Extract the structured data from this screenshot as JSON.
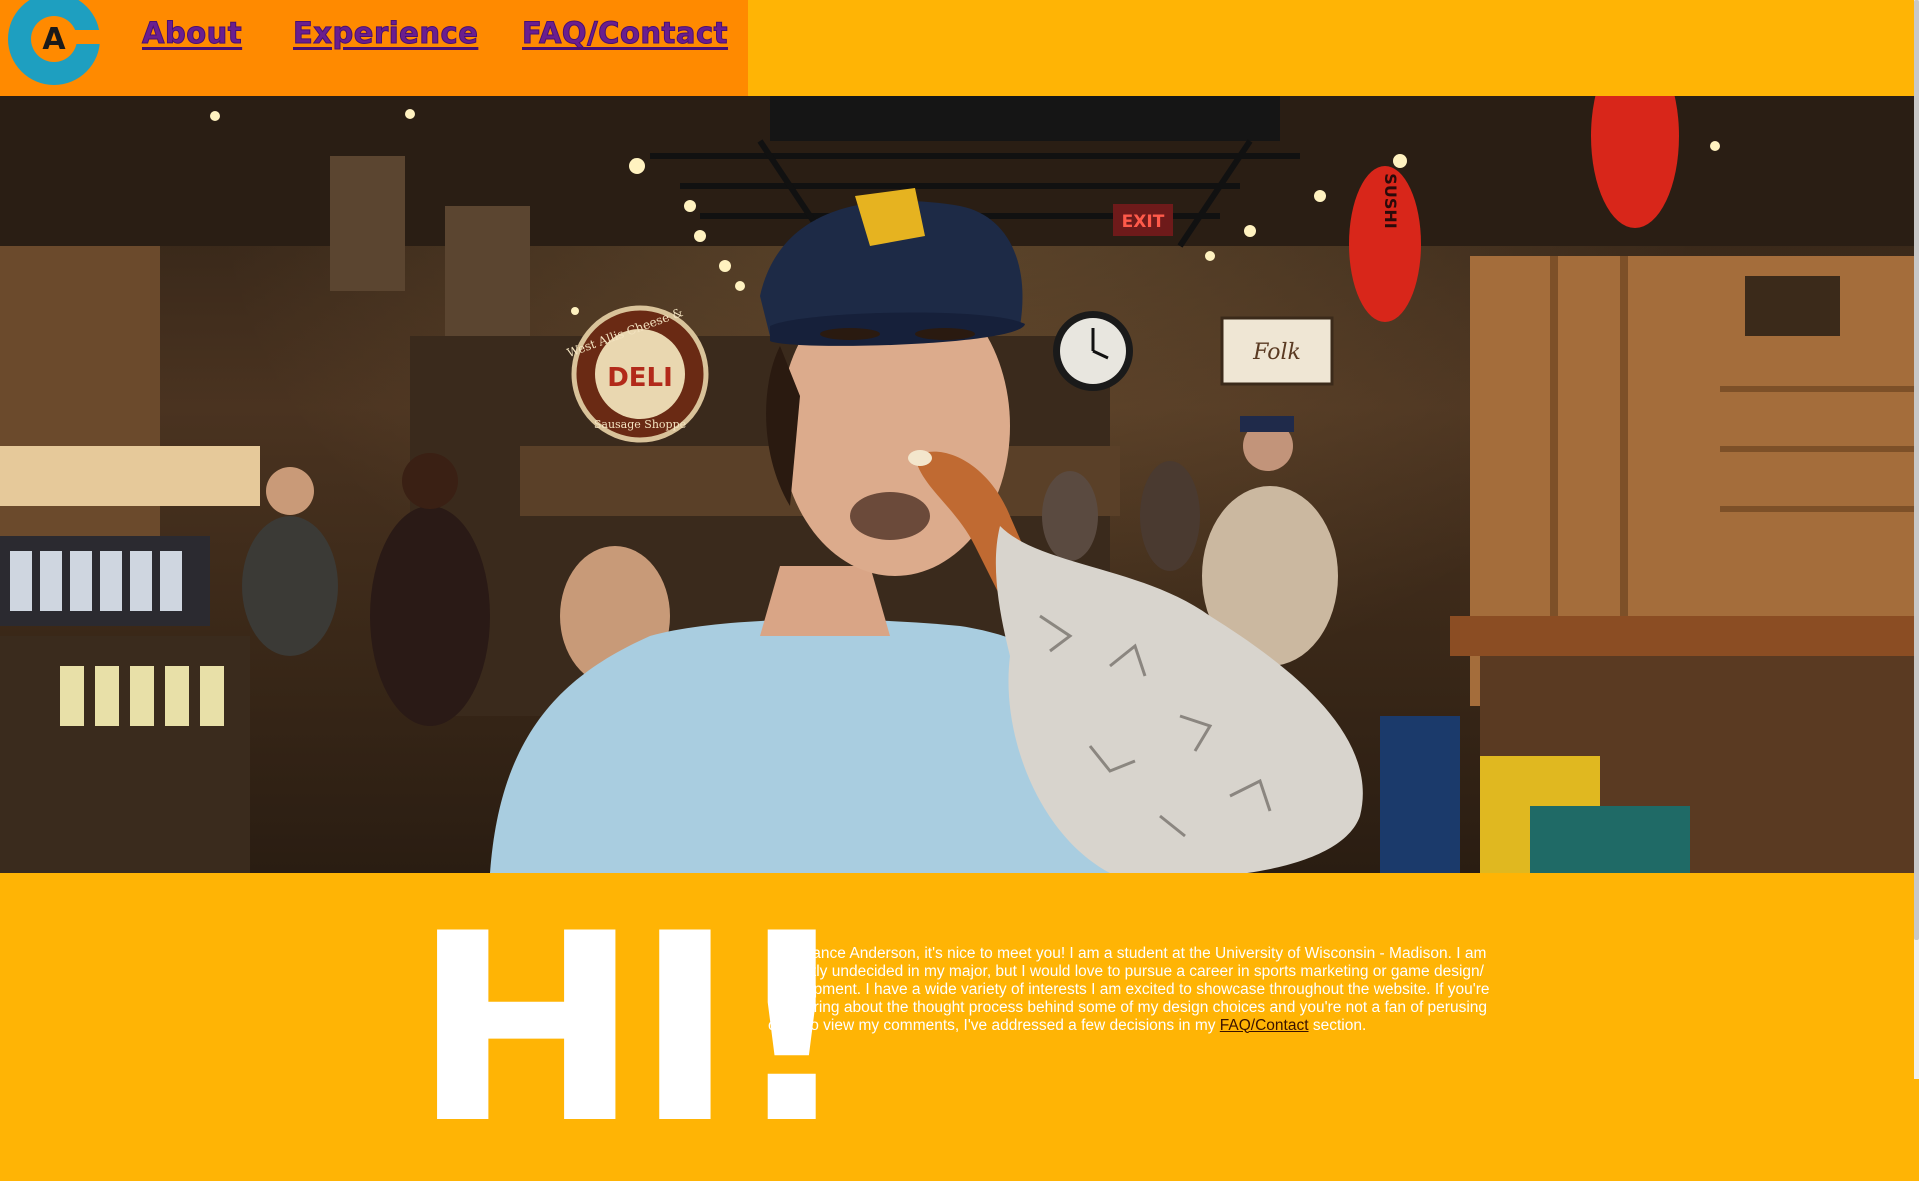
{
  "logo": {
    "letter": "A",
    "alt": "Chance Anderson logo"
  },
  "nav": {
    "about": "About",
    "experience": "Experience",
    "faq": "FAQ/Contact"
  },
  "hero": {
    "signs": {
      "deli_top": "West Allis Cheese &",
      "deli_main": "DELI",
      "deli_bottom": "Sausage Shoppe",
      "exit": "EXIT",
      "sushi": "SUSHI",
      "folk": "Folk"
    }
  },
  "intro": {
    "heading": "HI!",
    "text_before_link": "I'm Chance Anderson, it's nice to meet you! I am a student at the University of Wisconsin - Madison. I am currently undecided in my major, but I would love to pursue a career in sports marketing or game design/ development. I have a wide variety of interests I am excited to showcase throughout the website. If you're wondering about the thought process behind some of my design choices and you're not a fan of perusing code to view my comments, I've addressed a few decisions in my ",
    "link_label": "FAQ/Contact",
    "text_after_link": " section."
  },
  "colors": {
    "page_bg": "#FFB405",
    "nav_bg": "#FF8A00",
    "nav_link": "#6A1E8F",
    "logo_circle": "#1E9FC0"
  }
}
